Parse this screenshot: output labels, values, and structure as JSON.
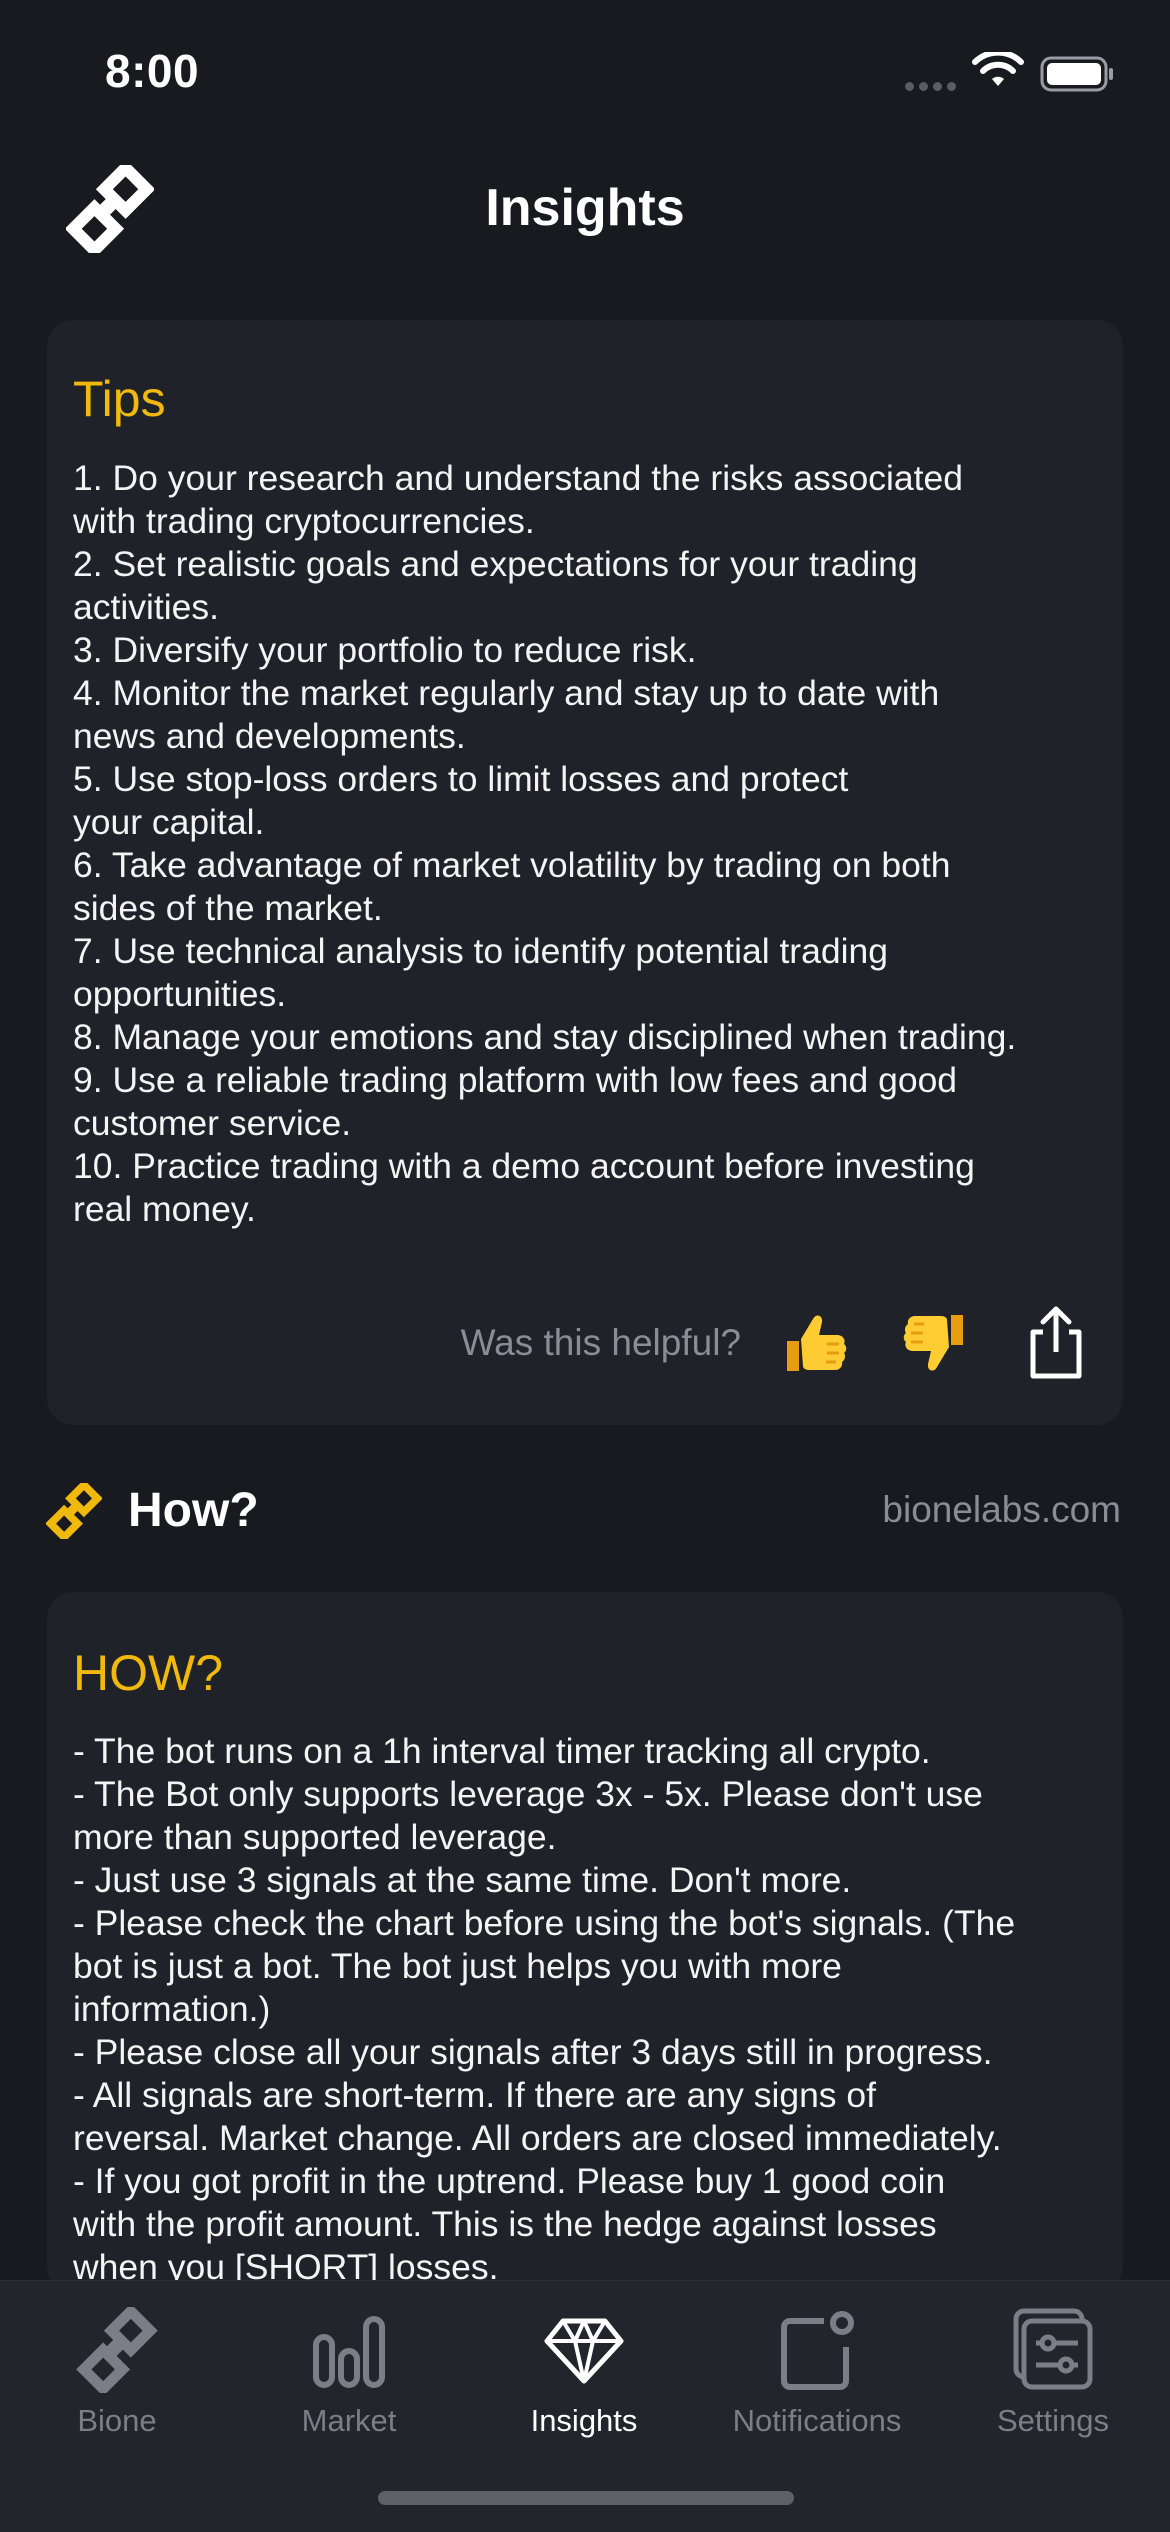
{
  "status_bar": {
    "time": "8:00"
  },
  "header": {
    "title": "Insights"
  },
  "tips_card": {
    "title": "Tips",
    "body": "1. Do your research and understand the risks associated\nwith trading cryptocurrencies.\n2. Set realistic goals and expectations for your trading\nactivities.\n3. Diversify your portfolio to reduce risk.\n4. Monitor the market regularly and stay up to date with\nnews and developments.\n5. Use stop-loss orders to limit losses and protect\nyour capital.\n6. Take advantage of market volatility by trading on both\nsides of the market.\n7. Use technical analysis to identify potential trading\nopportunities.\n8. Manage your emotions and stay disciplined when trading.\n9. Use a reliable trading platform with low fees and good\ncustomer service.\n10. Practice trading with a demo account before investing\nreal money.",
    "feedback_prompt": "Was this helpful?"
  },
  "how_section": {
    "label": "How?",
    "link": "bionelabs.com"
  },
  "how_card": {
    "title": "HOW?",
    "body": "- The bot runs on a 1h interval timer tracking all crypto.\n- The Bot only supports leverage 3x - 5x. Please don't use\nmore than supported leverage.\n- Just use 3 signals at the same time. Don't more.\n- Please check the chart before using the bot's signals. (The\nbot is just a bot. The bot just helps you with more\ninformation.)\n- Please close all your signals after 3 days still in progress.\n- All signals are short-term. If there are any signs of\nreversal. Market change. All orders are closed immediately.\n- If you got profit in the uptrend. Please buy 1 good coin\nwith the profit amount. This is the hedge against losses\nwhen you [SHORT] losses."
  },
  "tab_bar": {
    "tabs": [
      {
        "label": "Bione",
        "icon": "bione-logo-icon",
        "active": false
      },
      {
        "label": "Market",
        "icon": "bar-chart-icon",
        "active": false
      },
      {
        "label": "Insights",
        "icon": "diamond-icon",
        "active": true
      },
      {
        "label": "Notifications",
        "icon": "notification-icon",
        "active": false
      },
      {
        "label": "Settings",
        "icon": "settings-sliders-icon",
        "active": false
      }
    ]
  },
  "colors": {
    "background": "#181a20",
    "card": "#1f2229",
    "accent": "#f0b90b",
    "muted_text": "#8a8d96",
    "tab_bar": "#22252c"
  }
}
